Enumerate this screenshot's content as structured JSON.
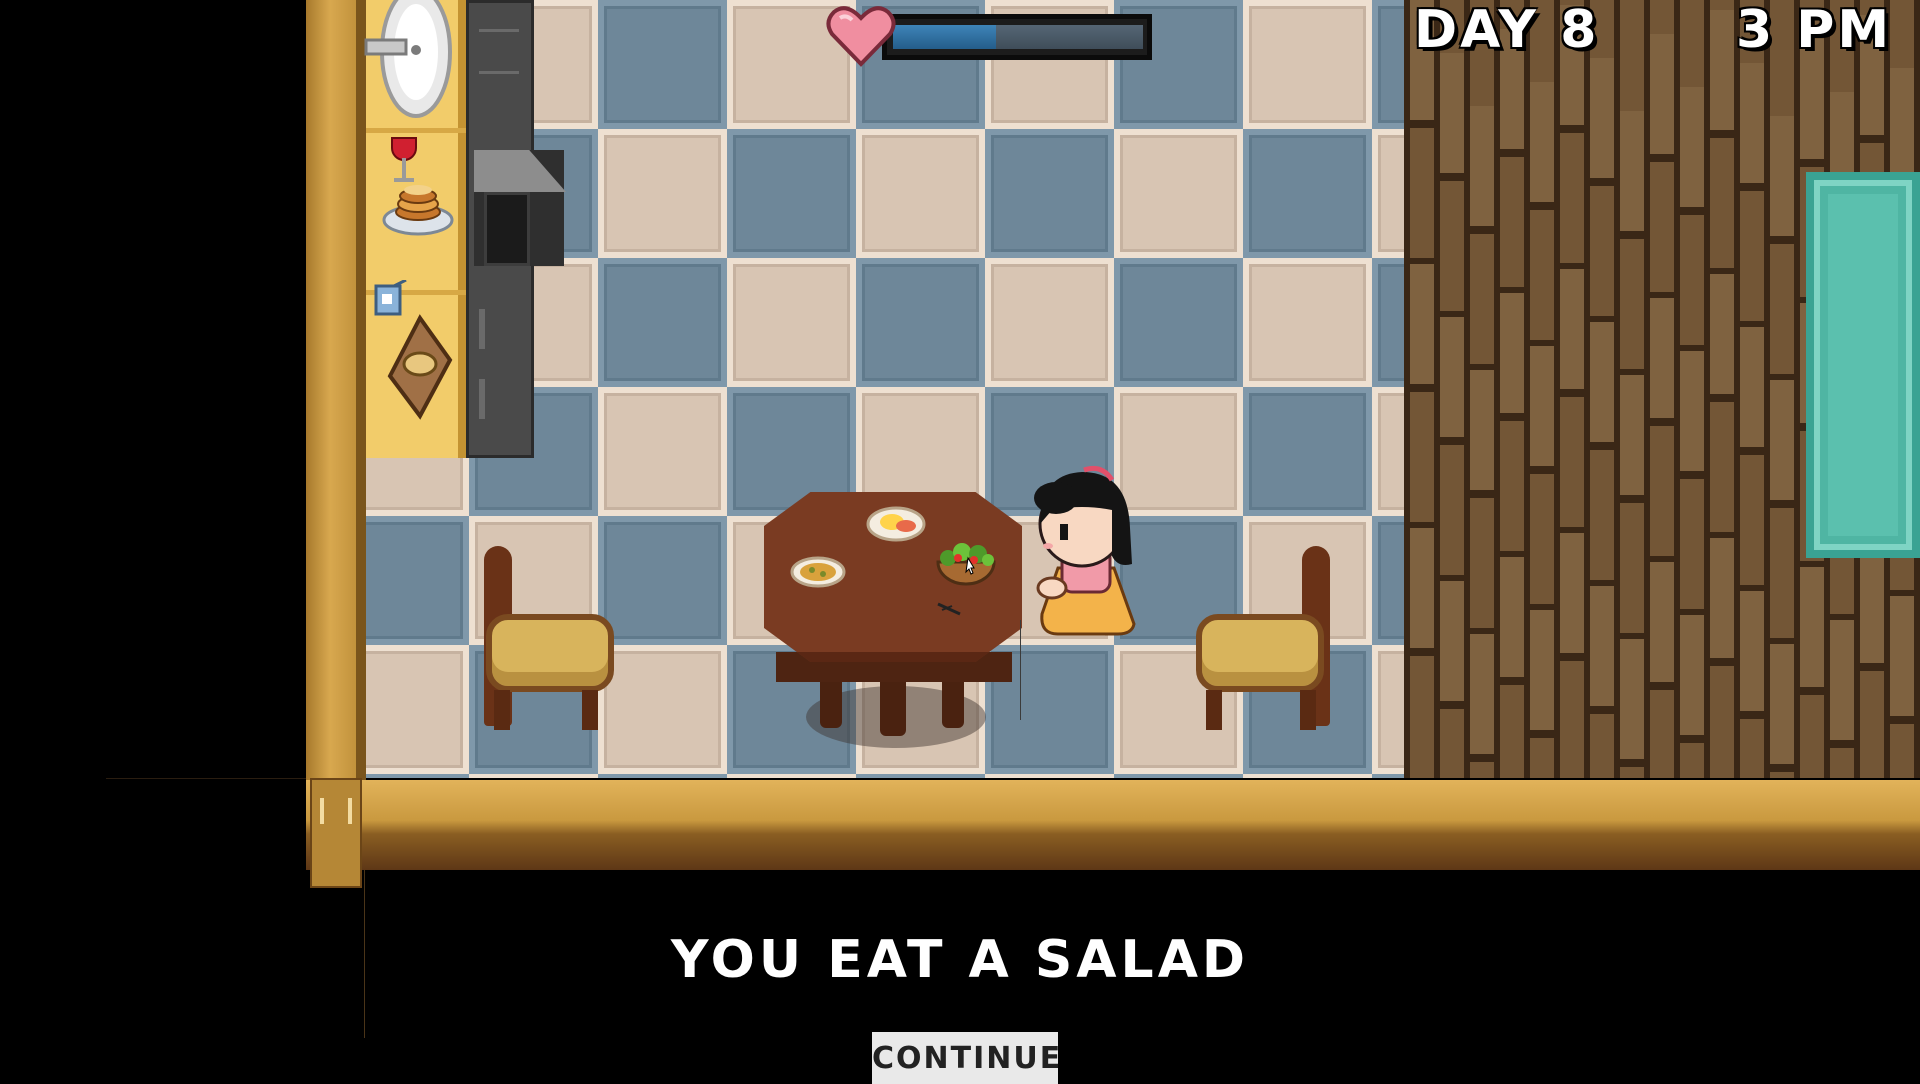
{
  "hud": {
    "day_label": "DAY 8",
    "time_label": "3 PM",
    "health_fraction": 0.41
  },
  "dialog": {
    "message": "YOU EAT A SALAD",
    "continue_label": "CONTINUE"
  },
  "colors": {
    "health_fill": "#3e84b8",
    "heart": "#f08ea0"
  }
}
